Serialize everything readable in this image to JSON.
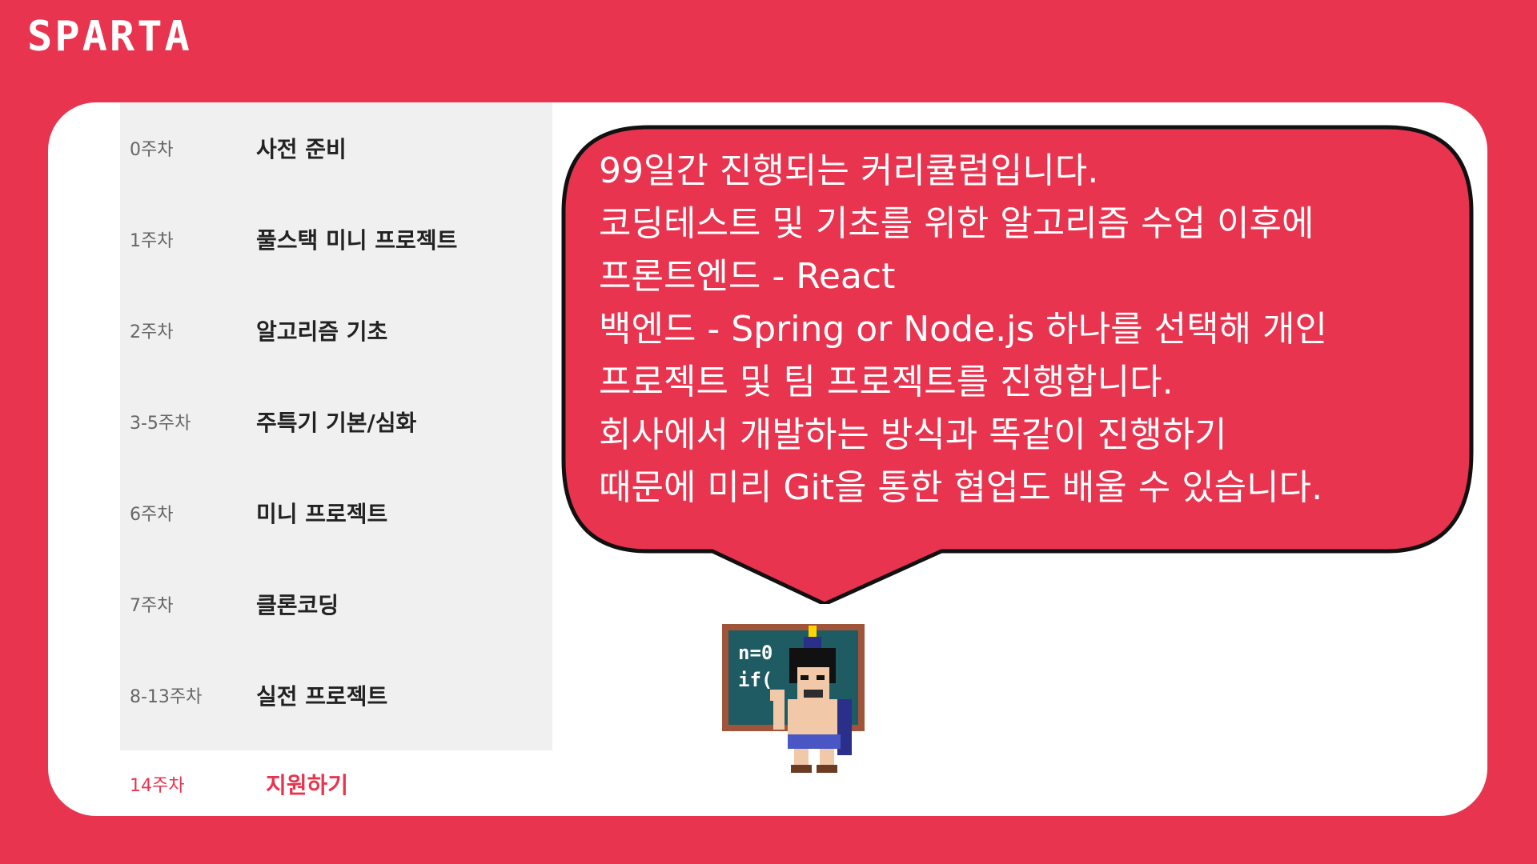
{
  "brand": {
    "logo": "SPARTA"
  },
  "curriculum": [
    {
      "week": "0주차",
      "title": "사전 준비"
    },
    {
      "week": "1주차",
      "title": "풀스택 미니 프로젝트"
    },
    {
      "week": "2주차",
      "title": "알고리즘 기초"
    },
    {
      "week": "3-5주차",
      "title": "주특기 기본/심화"
    },
    {
      "week": "6주차",
      "title": "미니 프로젝트"
    },
    {
      "week": "7주차",
      "title": "클론코딩"
    },
    {
      "week": "8-13주차",
      "title": "실전 프로젝트"
    },
    {
      "week": "14주차",
      "title": "지원하기"
    }
  ],
  "bubble": {
    "lines": [
      "99일간 진행되는 커리큘럼입니다.",
      "코딩테스트 및 기초를 위한 알고리즘 수업 이후에",
      "프론트엔드 - React",
      "백엔드 - Spring or Node.js 하나를 선택해 개인",
      "프로젝트 및 팀 프로젝트를 진행합니다.",
      "회사에서 개발하는 방식과 똑같이 진행하기",
      "때문에 미리 Git을 통한 협업도 배울 수 있습니다."
    ]
  },
  "mascot": {
    "icon": "spartan-teacher-icon",
    "board_lines": [
      "n=0",
      "if("
    ]
  },
  "colors": {
    "accent": "#e8344f",
    "panel": "#f0f0f0",
    "bubble_stroke": "#111111"
  }
}
